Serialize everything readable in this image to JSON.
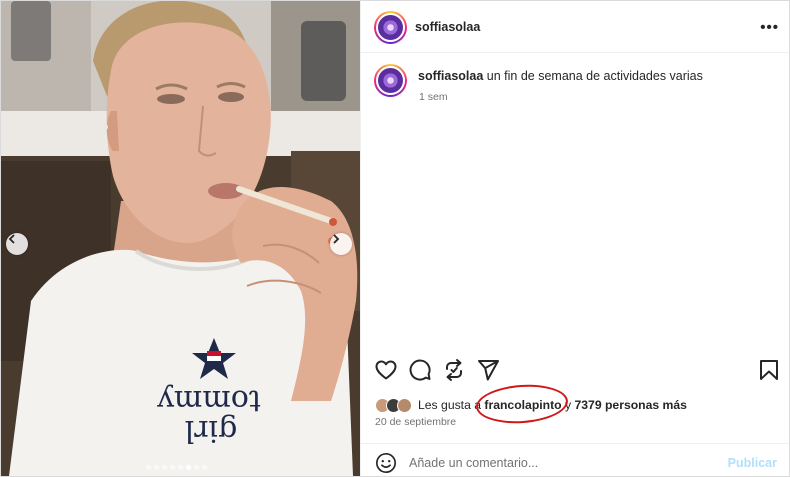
{
  "post": {
    "author": "soffiasolaa",
    "more_label": "•••",
    "caption": {
      "username": "soffiasolaa",
      "text": " un fin de semana de actividades varias",
      "time": "1 sem"
    },
    "media": {
      "shirt_text_line1": "tommy",
      "shirt_text_line2": "girl",
      "carousel_dots": 8,
      "active_dot": 6
    },
    "likes": {
      "prefix": "Les gusta a ",
      "highlighted_user": "francolapinto",
      "suffix": " y ",
      "count_text": "7379 personas más"
    },
    "date": "20 de septiembre",
    "comment": {
      "placeholder": "Añade un comentario...",
      "publish_label": "Publicar"
    },
    "icons": {
      "like": "heart-icon",
      "comment": "comment-icon",
      "repost": "repost-icon",
      "share": "send-icon",
      "save": "bookmark-icon",
      "emoji": "emoji-icon",
      "prev": "chevron-left-icon",
      "next": "chevron-right-icon"
    },
    "colors": {
      "highlight_circle": "#d01818",
      "publish_disabled": "#b2dffc"
    }
  }
}
